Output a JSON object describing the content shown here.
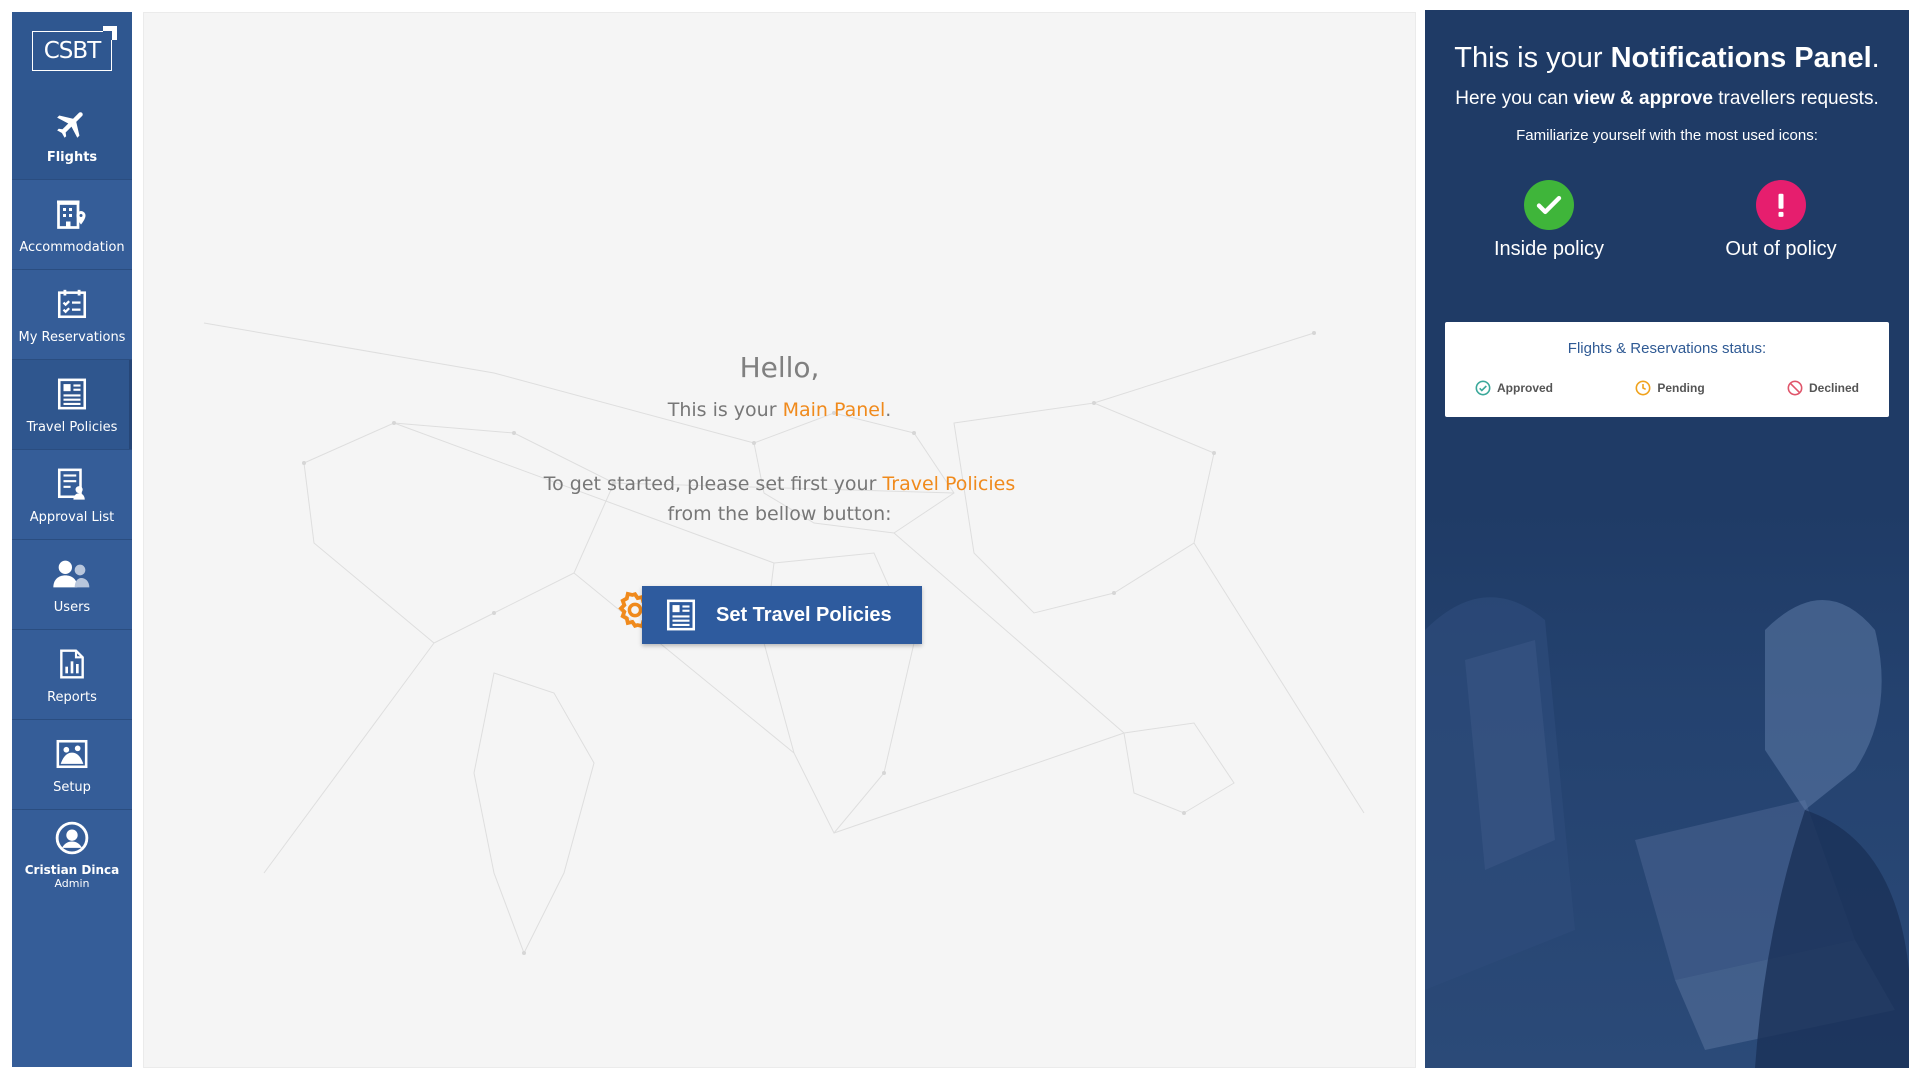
{
  "brand": {
    "logo_text": "CSBT"
  },
  "sidebar": {
    "items": [
      {
        "label": "Flights",
        "icon": "airplane-icon"
      },
      {
        "label": "Accommodation",
        "icon": "hotel-icon"
      },
      {
        "label": "My Reservations",
        "icon": "calendar-check-icon"
      },
      {
        "label": "Travel Policies",
        "icon": "policy-document-icon"
      },
      {
        "label": "Approval List",
        "icon": "approval-list-icon"
      },
      {
        "label": "Users",
        "icon": "users-icon"
      },
      {
        "label": "Reports",
        "icon": "reports-icon"
      },
      {
        "label": "Setup",
        "icon": "setup-icon"
      }
    ],
    "user": {
      "name": "Cristian Dinca",
      "role": "Admin"
    }
  },
  "main": {
    "greeting": "Hello,",
    "intro_prefix": "This is your ",
    "intro_link": "Main Panel",
    "intro_suffix": ".",
    "instruction_prefix": "To get started, please set first your ",
    "instruction_link": "Travel Policies",
    "instruction_line2": "from the bellow button:",
    "cta_label": "Set Travel Policies"
  },
  "notifications": {
    "title_prefix": "This is your ",
    "title_bold": "Notifications Panel",
    "title_suffix": ".",
    "subtitle_prefix": "Here you can ",
    "subtitle_bold": "view & approve",
    "subtitle_suffix": " travellers requests.",
    "familiarize": "Familiarize yourself with the most used icons:",
    "inside_policy": "Inside policy",
    "out_of_policy": "Out of policy",
    "status_title": "Flights & Reservations status:",
    "statuses": [
      {
        "label": "Approved",
        "color": "#3aa89a"
      },
      {
        "label": "Pending",
        "color": "#f0a21c"
      },
      {
        "label": "Declined",
        "color": "#e0556a"
      }
    ]
  },
  "colors": {
    "sidebar": "#355d98",
    "accent": "#f08a1c",
    "panel": "#1f3b66",
    "inside": "#3fb53a",
    "outside": "#e61e6e"
  }
}
